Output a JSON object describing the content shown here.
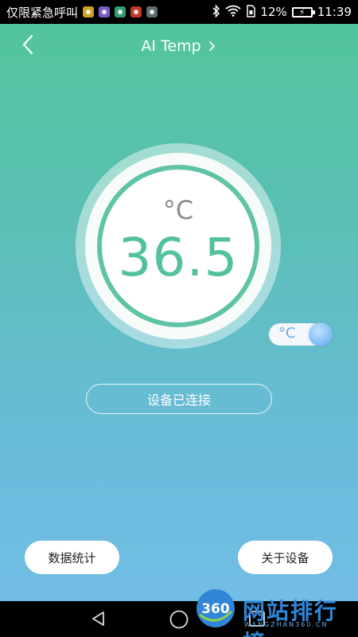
{
  "status_bar": {
    "carrier_text": "仅限紧急呼叫",
    "battery_percent": "12%",
    "time": "11:39",
    "notification_icons": [
      "notif-icon-1",
      "notif-icon-2",
      "notif-icon-3",
      "music-icon",
      "notif-icon-5"
    ]
  },
  "header": {
    "title": "AI Temp"
  },
  "gauge": {
    "unit": "°C",
    "value": "36.5",
    "colors": {
      "ring": "#5fc3a6",
      "value": "#52c29c",
      "unit": "#8d8d8d"
    }
  },
  "unit_toggle": {
    "label": "°C"
  },
  "connection": {
    "status_text": "设备已连接"
  },
  "buttons": {
    "stats_label": "数据统计",
    "about_label": "关于设备"
  },
  "watermark": {
    "logo_number": "360",
    "text": "网站排行榜",
    "sub": "WANGZHAN360.CN"
  }
}
